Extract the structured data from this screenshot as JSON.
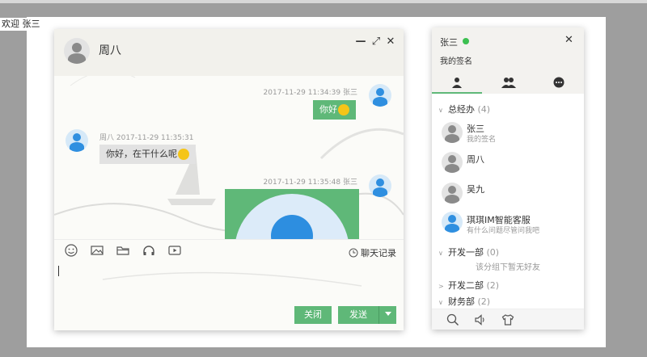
{
  "welcome": "欢迎 张三",
  "chat": {
    "title": "周八",
    "window": {
      "minimize": "—",
      "maximize": "⤢",
      "close": "✕"
    },
    "messages": [
      {
        "meta": "2017-11-29 11:34:39   张三",
        "text": "你好"
      },
      {
        "meta": "周八   2017-11-29 11:35:31",
        "text": "你好，在干什么呢"
      },
      {
        "meta": "2017-11-29 11:35:48   张三"
      }
    ],
    "toolbar": {
      "icons": [
        "smile-icon",
        "image-icon",
        "folder-icon",
        "headphone-icon",
        "video-icon"
      ],
      "history_label": "聊天记录"
    },
    "buttons": {
      "close": "关闭",
      "send": "发送"
    }
  },
  "panel": {
    "user_name": "张三",
    "signature": "我的签名",
    "close": "✕",
    "tabs": [
      "friends-tab",
      "groups-tab",
      "history-tab"
    ],
    "groups": [
      {
        "name": "总经办",
        "count": "(4)"
      },
      {
        "name": "开发一部",
        "count": "(0)"
      },
      {
        "name": "开发二部",
        "count": "(2)"
      },
      {
        "name": "财务部",
        "count": "(2)"
      }
    ],
    "contacts": [
      {
        "name": "张三",
        "sign": "我的签名"
      },
      {
        "name": "周八",
        "sign": ""
      },
      {
        "name": "吴九",
        "sign": ""
      },
      {
        "name": "琪琪IM智能客服",
        "sign": "有什么问题尽管问我吧"
      }
    ],
    "empty_text": "该分组下暂无好友",
    "bottom_icons": [
      "search-icon",
      "sound-icon",
      "skin-icon"
    ]
  },
  "colors": {
    "accent": "#5FB878",
    "online": "#3CC051",
    "avatar_blue": "#2F8FE0"
  }
}
